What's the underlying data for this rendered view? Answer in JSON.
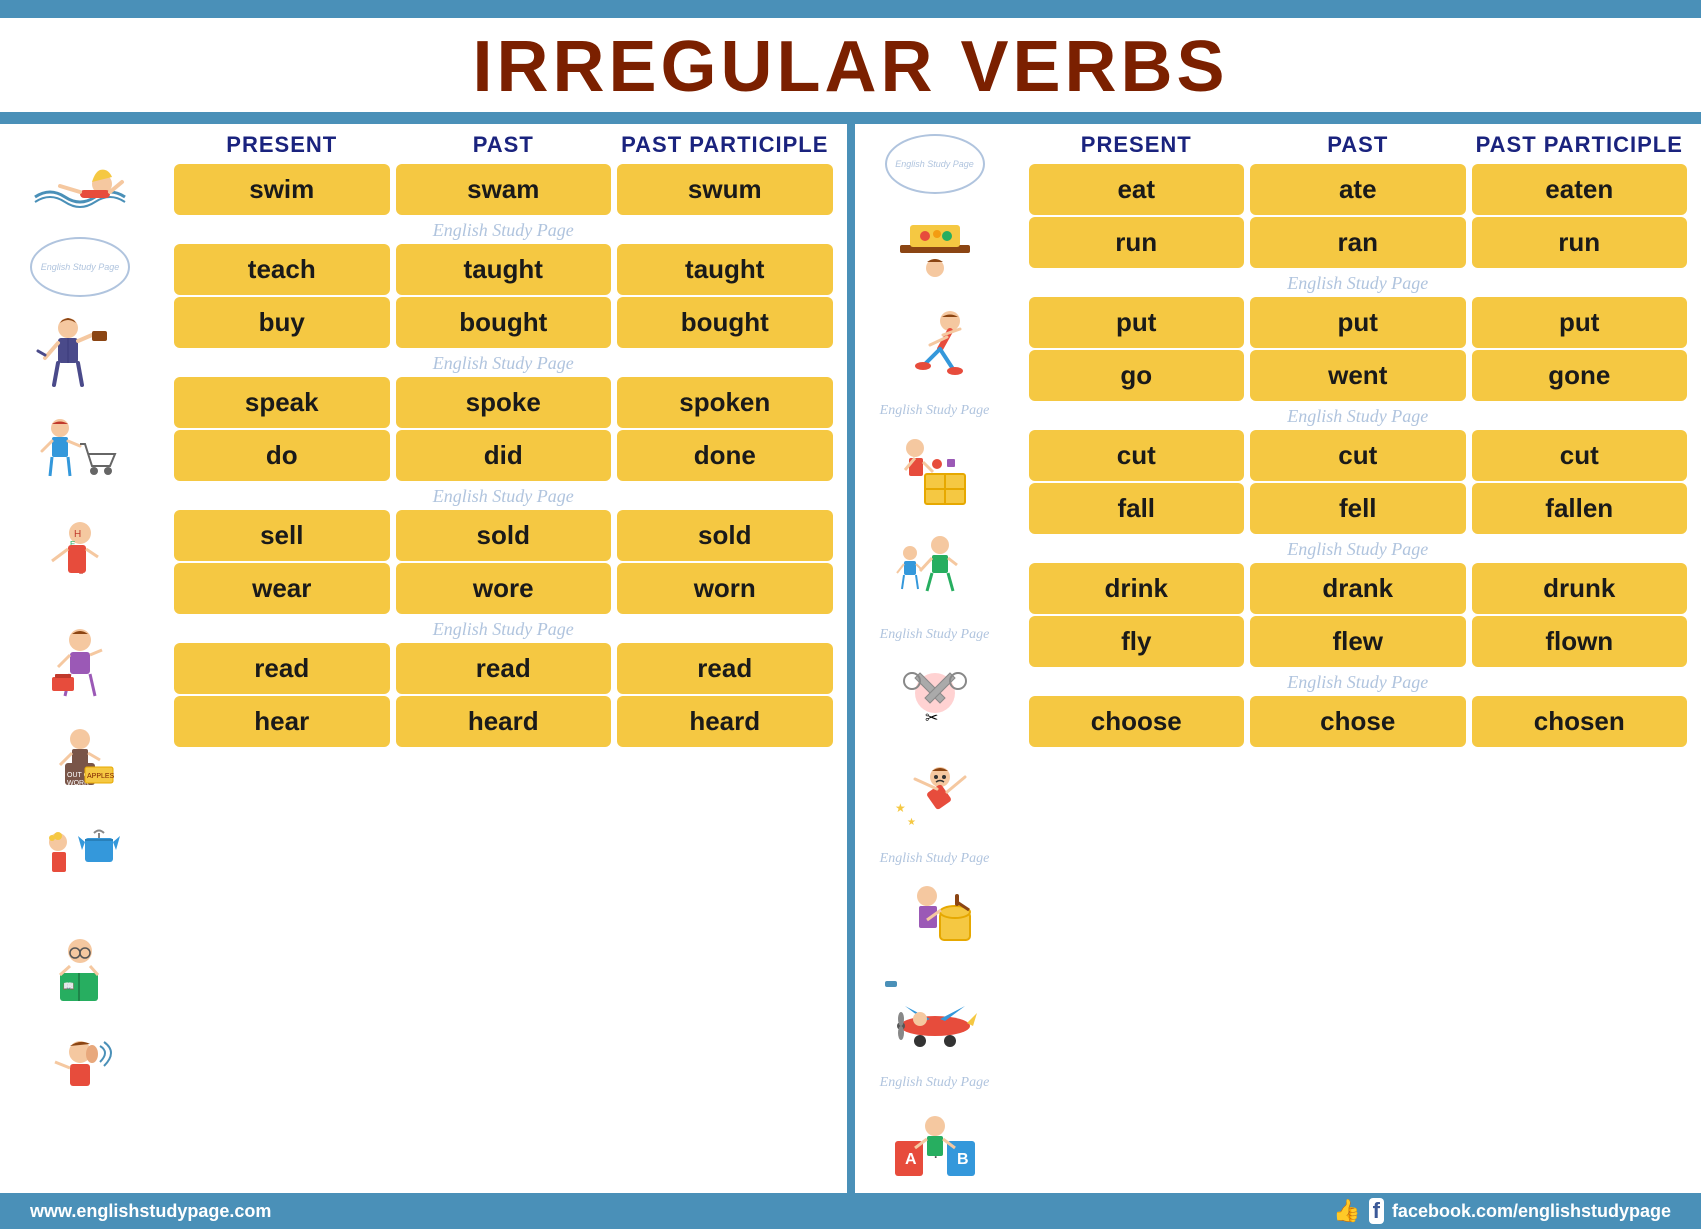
{
  "title": "IRREGULAR VERBS",
  "columns": {
    "present": "PRESENT",
    "past": "PAST",
    "past_participle": "PAST PARTICIPLE"
  },
  "watermark_text": "English Study Page",
  "left_verbs": [
    {
      "present": "swim",
      "past": "swam",
      "past_participle": "swum"
    },
    {
      "watermark": true
    },
    {
      "present": "teach",
      "past": "taught",
      "past_participle": "taught"
    },
    {
      "present": "buy",
      "past": "bought",
      "past_participle": "bought"
    },
    {
      "watermark": true
    },
    {
      "present": "speak",
      "past": "spoke",
      "past_participle": "spoken"
    },
    {
      "present": "do",
      "past": "did",
      "past_participle": "done"
    },
    {
      "watermark": true
    },
    {
      "present": "sell",
      "past": "sold",
      "past_participle": "sold"
    },
    {
      "present": "wear",
      "past": "wore",
      "past_participle": "worn"
    },
    {
      "watermark": true
    },
    {
      "present": "read",
      "past": "read",
      "past_participle": "read"
    },
    {
      "present": "hear",
      "past": "heard",
      "past_participle": "heard"
    }
  ],
  "right_verbs": [
    {
      "present": "eat",
      "past": "ate",
      "past_participle": "eaten"
    },
    {
      "present": "run",
      "past": "ran",
      "past_participle": "run"
    },
    {
      "watermark": true
    },
    {
      "present": "put",
      "past": "put",
      "past_participle": "put"
    },
    {
      "present": "go",
      "past": "went",
      "past_participle": "gone"
    },
    {
      "watermark": true
    },
    {
      "present": "cut",
      "past": "cut",
      "past_participle": "cut"
    },
    {
      "present": "fall",
      "past": "fell",
      "past_participle": "fallen"
    },
    {
      "watermark": true
    },
    {
      "present": "drink",
      "past": "drank",
      "past_participle": "drunk"
    },
    {
      "present": "fly",
      "past": "flew",
      "past_participle": "flown"
    },
    {
      "watermark": true
    },
    {
      "present": "choose",
      "past": "chose",
      "past_participle": "chosen"
    }
  ],
  "bottom": {
    "website": "www.englishstudypage.com",
    "facebook": "facebook.com/englishstudypage"
  },
  "illustrations_left": [
    "🏊",
    "👩‍🏫",
    "🛒",
    "🧒",
    "📚",
    "👕",
    "📖",
    "👂"
  ],
  "illustrations_right": [
    "🍽️",
    "🏃",
    "📦",
    "🚶‍♂️",
    "✂️",
    "🍺",
    "✈️",
    "📚"
  ]
}
